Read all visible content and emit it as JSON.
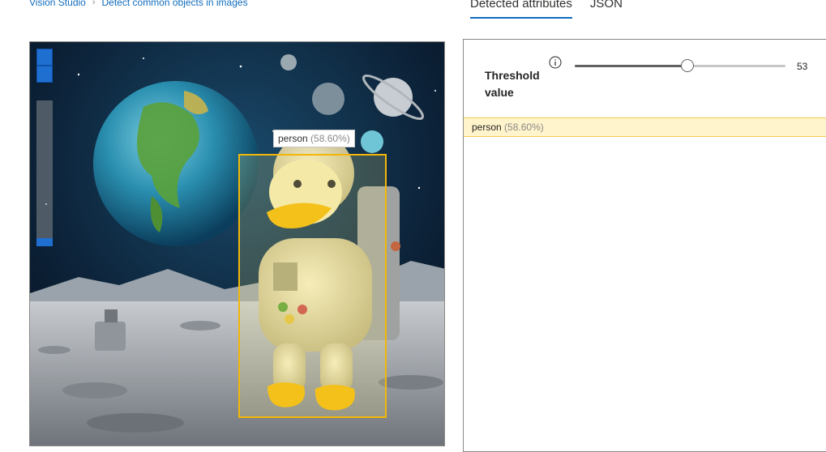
{
  "breadcrumb": {
    "root": "Vision Studio",
    "current": "Detect common objects in images"
  },
  "tabs": [
    {
      "label": "Detected attributes",
      "active": true
    },
    {
      "label": "JSON",
      "active": false
    }
  ],
  "image_viewer": {
    "detection": {
      "label": "person",
      "confidence": "(58.60%)"
    },
    "zoom_level": 0.05
  },
  "threshold": {
    "label": "Threshold value",
    "value": "53",
    "fraction": 0.53
  },
  "results": [
    {
      "label": "person",
      "confidence": "(58.60%)"
    }
  ],
  "colors": {
    "accent": "#0f6cbd",
    "bbox": "#f2b70a",
    "result_highlight": "#fff4cc"
  },
  "icons": {
    "breadcrumb_separator": "chevron-right-icon",
    "info": "info-icon",
    "zoom": "zoom-slider"
  }
}
